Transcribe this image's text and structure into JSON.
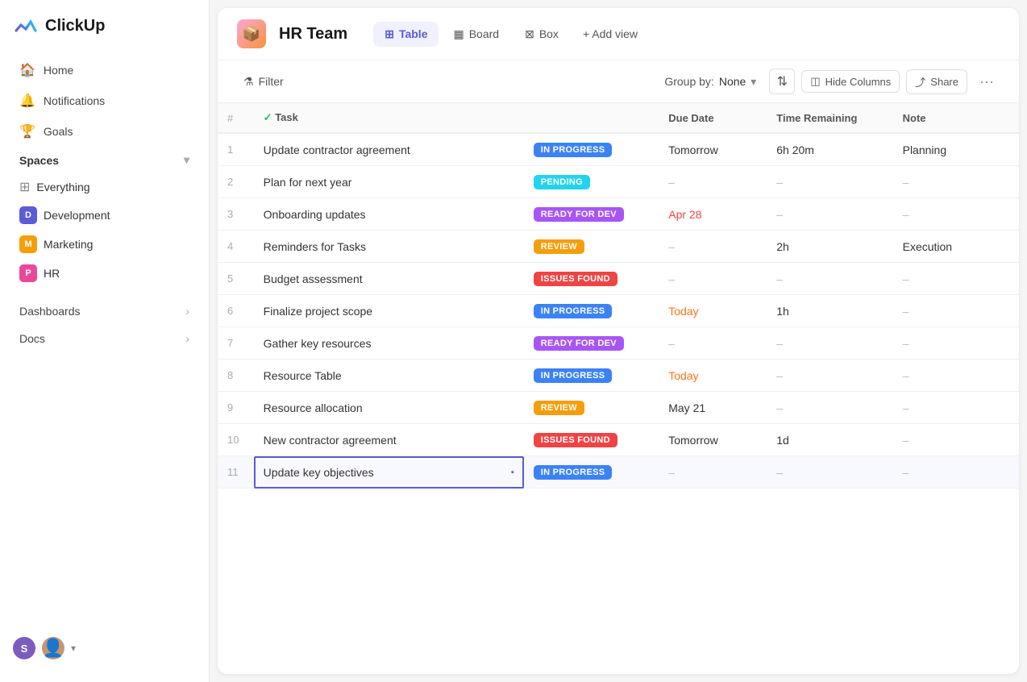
{
  "app": {
    "name": "ClickUp"
  },
  "sidebar": {
    "nav": [
      {
        "id": "home",
        "label": "Home",
        "icon": "🏠"
      },
      {
        "id": "notifications",
        "label": "Notifications",
        "icon": "🔔"
      },
      {
        "id": "goals",
        "label": "Goals",
        "icon": "🏆"
      }
    ],
    "spaces_label": "Spaces",
    "spaces": [
      {
        "id": "everything",
        "label": "Everything",
        "icon": "⊞",
        "color": null
      },
      {
        "id": "development",
        "label": "Development",
        "initial": "D",
        "color": "#5b5bd6"
      },
      {
        "id": "marketing",
        "label": "Marketing",
        "initial": "M",
        "color": "#f59e0b"
      },
      {
        "id": "hr",
        "label": "HR",
        "initial": "P",
        "color": "#ec4899"
      }
    ],
    "dashboards_label": "Dashboards",
    "docs_label": "Docs"
  },
  "workspace": {
    "icon": "📦",
    "title": "HR Team"
  },
  "views": [
    {
      "id": "table",
      "label": "Table",
      "icon": "⊞",
      "active": true
    },
    {
      "id": "board",
      "label": "Board",
      "icon": "▦",
      "active": false
    },
    {
      "id": "box",
      "label": "Box",
      "icon": "⊠",
      "active": false
    }
  ],
  "add_view_label": "+ Add view",
  "toolbar": {
    "filter_label": "Filter",
    "groupby_label": "Group by:",
    "groupby_value": "None",
    "hide_columns_label": "Hide Columns",
    "share_label": "Share"
  },
  "table": {
    "columns": [
      {
        "id": "num",
        "label": "#"
      },
      {
        "id": "task",
        "label": "Task"
      },
      {
        "id": "status",
        "label": ""
      },
      {
        "id": "duedate",
        "label": "Due Date"
      },
      {
        "id": "timeremaining",
        "label": "Time Remaining"
      },
      {
        "id": "note",
        "label": "Note"
      }
    ],
    "rows": [
      {
        "num": 1,
        "task": "Update contractor agreement",
        "status": "IN PROGRESS",
        "status_type": "in-progress",
        "due_date": "Tomorrow",
        "due_type": "normal",
        "time_remaining": "6h 20m",
        "note": "Planning"
      },
      {
        "num": 2,
        "task": "Plan for next year",
        "status": "PENDING",
        "status_type": "pending",
        "due_date": "–",
        "due_type": "dash",
        "time_remaining": "–",
        "note": "–"
      },
      {
        "num": 3,
        "task": "Onboarding updates",
        "status": "READY FOR DEV",
        "status_type": "ready-for-dev",
        "due_date": "Apr 28",
        "due_type": "apr",
        "time_remaining": "–",
        "note": "–"
      },
      {
        "num": 4,
        "task": "Reminders for Tasks",
        "status": "REVIEW",
        "status_type": "review",
        "due_date": "–",
        "due_type": "dash",
        "time_remaining": "2h",
        "note": "Execution"
      },
      {
        "num": 5,
        "task": "Budget assessment",
        "status": "ISSUES FOUND",
        "status_type": "issues-found",
        "due_date": "–",
        "due_type": "dash",
        "time_remaining": "–",
        "note": "–"
      },
      {
        "num": 6,
        "task": "Finalize project scope",
        "status": "IN PROGRESS",
        "status_type": "in-progress",
        "due_date": "Today",
        "due_type": "today",
        "time_remaining": "1h",
        "note": "–"
      },
      {
        "num": 7,
        "task": "Gather key resources",
        "status": "READY FOR DEV",
        "status_type": "ready-for-dev",
        "due_date": "–",
        "due_type": "dash",
        "time_remaining": "–",
        "note": "–"
      },
      {
        "num": 8,
        "task": "Resource Table",
        "status": "IN PROGRESS",
        "status_type": "in-progress",
        "due_date": "Today",
        "due_type": "today",
        "time_remaining": "–",
        "note": "–"
      },
      {
        "num": 9,
        "task": "Resource allocation",
        "status": "REVIEW",
        "status_type": "review",
        "due_date": "May 21",
        "due_type": "normal",
        "time_remaining": "–",
        "note": "–"
      },
      {
        "num": 10,
        "task": "New contractor agreement",
        "status": "ISSUES FOUND",
        "status_type": "issues-found",
        "due_date": "Tomorrow",
        "due_type": "normal",
        "time_remaining": "1d",
        "note": "–"
      },
      {
        "num": 11,
        "task": "Update key objectives",
        "status": "IN PROGRESS",
        "status_type": "in-progress",
        "due_date": "–",
        "due_type": "dash",
        "time_remaining": "–",
        "note": "–",
        "selected": true
      }
    ]
  }
}
